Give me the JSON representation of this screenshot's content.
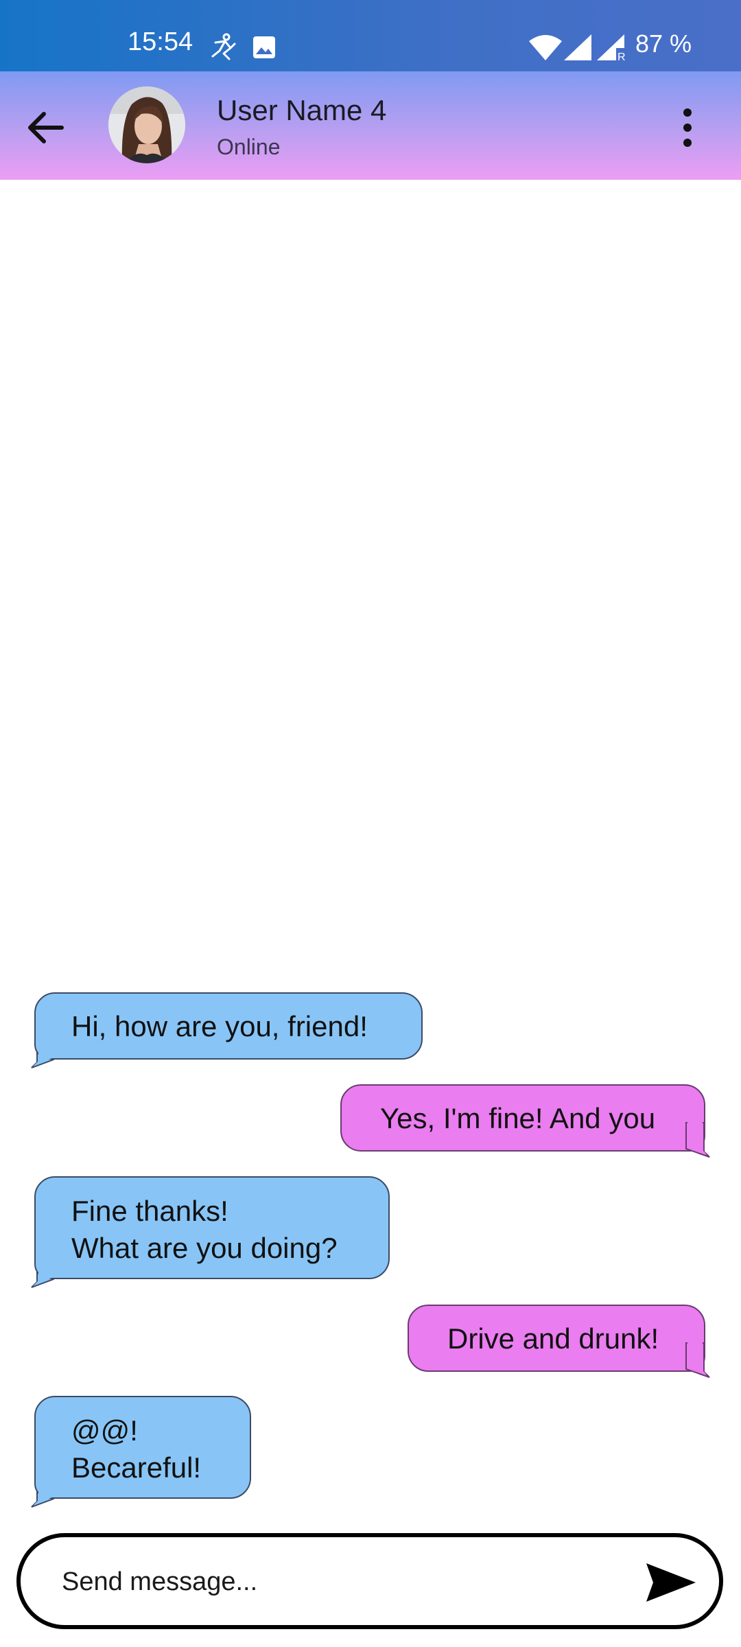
{
  "status_bar": {
    "time": "15:54",
    "battery": "87 %",
    "icons": [
      "accessibility-icon",
      "image-icon",
      "wifi-icon",
      "signal-icon",
      "signal-roaming-icon"
    ]
  },
  "header": {
    "contact_name": "User Name 4",
    "contact_status": "Online",
    "back_icon": "arrow-left-icon",
    "menu_icon": "more-vert-icon"
  },
  "messages": [
    {
      "direction": "incoming",
      "text": "Hi, how are you, friend!"
    },
    {
      "direction": "outgoing",
      "text": "Yes, I'm fine! And you"
    },
    {
      "direction": "incoming",
      "text": "Fine thanks!\nWhat are you doing?"
    },
    {
      "direction": "outgoing",
      "text": "Drive and drunk!"
    },
    {
      "direction": "incoming",
      "text": "@@!\nBecareful!"
    }
  ],
  "composer": {
    "placeholder": "Send message...",
    "value": "",
    "send_icon": "send-icon"
  },
  "colors": {
    "status_bar": "#1674c7",
    "header_top": "#7f9af2",
    "header_bottom": "#ed9ef4",
    "incoming_bubble": "#88c5f6",
    "outgoing_bubble": "#ea7df0"
  }
}
